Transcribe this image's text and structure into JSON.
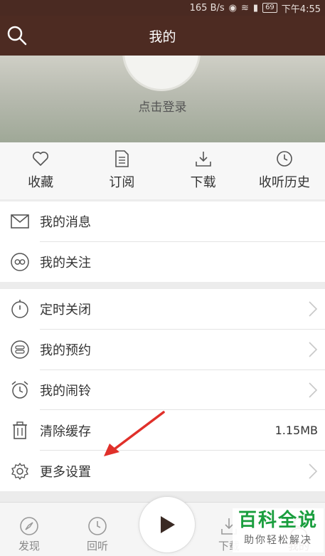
{
  "status_bar": {
    "speed": "165 B/s",
    "battery": "69",
    "time": "下午4:55"
  },
  "header": {
    "title": "我的"
  },
  "profile": {
    "login_text": "点击登录"
  },
  "quick_actions": [
    {
      "label": "收藏",
      "icon": "heart-icon"
    },
    {
      "label": "订阅",
      "icon": "document-icon"
    },
    {
      "label": "下载",
      "icon": "download-icon"
    },
    {
      "label": "收听历史",
      "icon": "clock-icon"
    }
  ],
  "menu_group_1": [
    {
      "label": "我的消息",
      "icon": "mail-icon"
    },
    {
      "label": "我的关注",
      "icon": "infinity-icon"
    }
  ],
  "menu_group_2": [
    {
      "label": "定时关闭",
      "icon": "timer-icon"
    },
    {
      "label": "我的预约",
      "icon": "reservation-icon"
    },
    {
      "label": "我的闹铃",
      "icon": "alarm-icon"
    },
    {
      "label": "清除缓存",
      "icon": "trash-icon",
      "value": "1.15MB"
    },
    {
      "label": "更多设置",
      "icon": "gear-icon"
    }
  ],
  "tab_bar": [
    {
      "label": "发现",
      "icon": "compass-icon"
    },
    {
      "label": "回听",
      "icon": "clock-icon"
    },
    {
      "label": "下载",
      "icon": "download-icon"
    },
    {
      "label": "我的",
      "icon": "user-icon"
    }
  ],
  "watermark": {
    "main": "百科全说",
    "sub": "助你轻松解决"
  },
  "colors": {
    "header_bg": "#4d2b22",
    "annotation_red": "#e0302a",
    "watermark_green": "#1a9e3e"
  }
}
